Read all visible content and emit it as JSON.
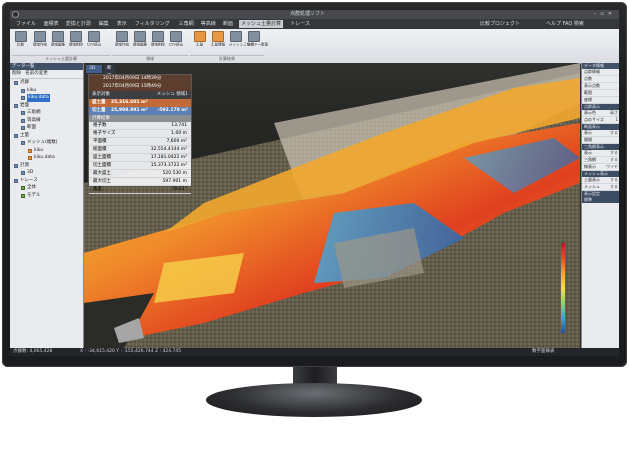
{
  "app": {
    "title": "点群処理ソフト",
    "menu": [
      "ファイル",
      "面積表",
      "変換と計測",
      "編集",
      "表示",
      "フィルタリング",
      "三角網",
      "等高線",
      "断面",
      "メッシュ土量計算",
      "トレース"
    ],
    "menu_active_index": 9,
    "menu_right": [
      "比較プロジェクト",
      "ヘルプ FAQ 検索"
    ]
  },
  "ribbon": {
    "buttons": [
      "比較",
      "領域作成",
      "領域編集",
      "領域削除",
      "CSV読込",
      "領域作成",
      "領域編集",
      "領域削除",
      "CSV読込",
      "土量",
      "土量情報",
      "メッシュ三角網",
      "ワイヤー断面"
    ],
    "groups": [
      "メッシュ土量計算",
      "領域",
      "計算結果"
    ]
  },
  "left_panel": {
    "title": "データ一覧",
    "tabs": [
      "削除",
      "名前の変更"
    ],
    "tree": [
      {
        "label": "点群",
        "level": 0,
        "icon": "folder"
      },
      {
        "label": "kiku",
        "level": 1,
        "icon": "points"
      },
      {
        "label": "kiku.data",
        "level": 1,
        "icon": "points",
        "selected": true
      },
      {
        "label": "岩盤",
        "level": 0,
        "icon": "folder"
      },
      {
        "label": "三角網",
        "level": 1,
        "icon": "mesh"
      },
      {
        "label": "等高線",
        "level": 1,
        "icon": "line"
      },
      {
        "label": "断面",
        "level": 1,
        "icon": "section"
      },
      {
        "label": "土量",
        "level": 0,
        "icon": "folder"
      },
      {
        "label": "メッシュ(複数)",
        "level": 1,
        "icon": "mesh"
      },
      {
        "label": "kiku",
        "level": 2,
        "icon": "orange"
      },
      {
        "label": "kiku.data",
        "level": 2,
        "icon": "orange"
      },
      {
        "label": "計測",
        "level": 0,
        "icon": "folder"
      },
      {
        "label": "3D",
        "level": 1,
        "icon": "points"
      },
      {
        "label": "トレース",
        "level": 0,
        "icon": "folder"
      },
      {
        "label": "全体",
        "level": 1,
        "icon": "green"
      },
      {
        "label": "モデル",
        "level": 1,
        "icon": "green"
      }
    ]
  },
  "viewport": {
    "tabs": [
      "3D",
      "断面表示"
    ],
    "info": {
      "date1": "2017年04月09日 14時39分",
      "date2": "2017年04月09日 15時49分",
      "header_k": "表示対象",
      "header_v": "メッシュ 領域1",
      "fill_label": "盛土量",
      "fill_value": "25,316.601 m³",
      "cut_label": "切土量",
      "cut_value": "25,908.891 m³",
      "net_value": "-592.170 m³",
      "section": "計算結果",
      "props": [
        {
          "k": "格子数",
          "v": "13,741"
        },
        {
          "k": "格子サイズ",
          "v": "1.00 m"
        },
        {
          "k": "平面積",
          "v": "7,600 m²"
        },
        {
          "k": "総面積",
          "v": "32,554.4144 m²"
        },
        {
          "k": "盛土面積",
          "v": "17,181.0422 m²"
        },
        {
          "k": "切土面積",
          "v": "15,373.3722 m²"
        },
        {
          "k": "最大盛土",
          "v": "520.530 m"
        },
        {
          "k": "最大切土",
          "v": "597.901 m"
        },
        {
          "k": "角度",
          "v": "59.61°"
        }
      ]
    }
  },
  "right_panel": {
    "sections": [
      {
        "title": "データ情報",
        "rows": [
          {
            "k": "点群情報",
            "v": ""
          },
          {
            "k": "点数",
            "v": ""
          },
          {
            "k": "表示点数",
            "v": ""
          },
          {
            "k": "範囲",
            "v": ""
          },
          {
            "k": "座標",
            "v": ""
          }
        ]
      },
      {
        "title": "点群表示",
        "rows": [
          {
            "k": "表示色",
            "v": "高さ"
          },
          {
            "k": "点のサイズ",
            "v": "1"
          }
        ]
      },
      {
        "title": "断面表示",
        "rows": [
          {
            "k": "表示",
            "v": "する"
          },
          {
            "k": "間隔",
            "v": ""
          }
        ]
      },
      {
        "title": "三角網表示",
        "rows": [
          {
            "k": "表示",
            "v": "する"
          },
          {
            "k": "三角網",
            "v": "する"
          },
          {
            "k": "線表示",
            "v": "ワイヤ"
          }
        ]
      },
      {
        "title": "メッシュ表示",
        "rows": [
          {
            "k": "土量表示",
            "v": "する"
          },
          {
            "k": "メッシュ",
            "v": "する"
          }
        ]
      },
      {
        "title": "表示設定",
        "rows": []
      },
      {
        "title": "標準",
        "rows": []
      }
    ]
  },
  "status": {
    "points": "点群数: 4,065,428",
    "coords": "X : -34,615.420  Y : -155,426.744  Z : 424.745",
    "right": "数字面横表"
  }
}
